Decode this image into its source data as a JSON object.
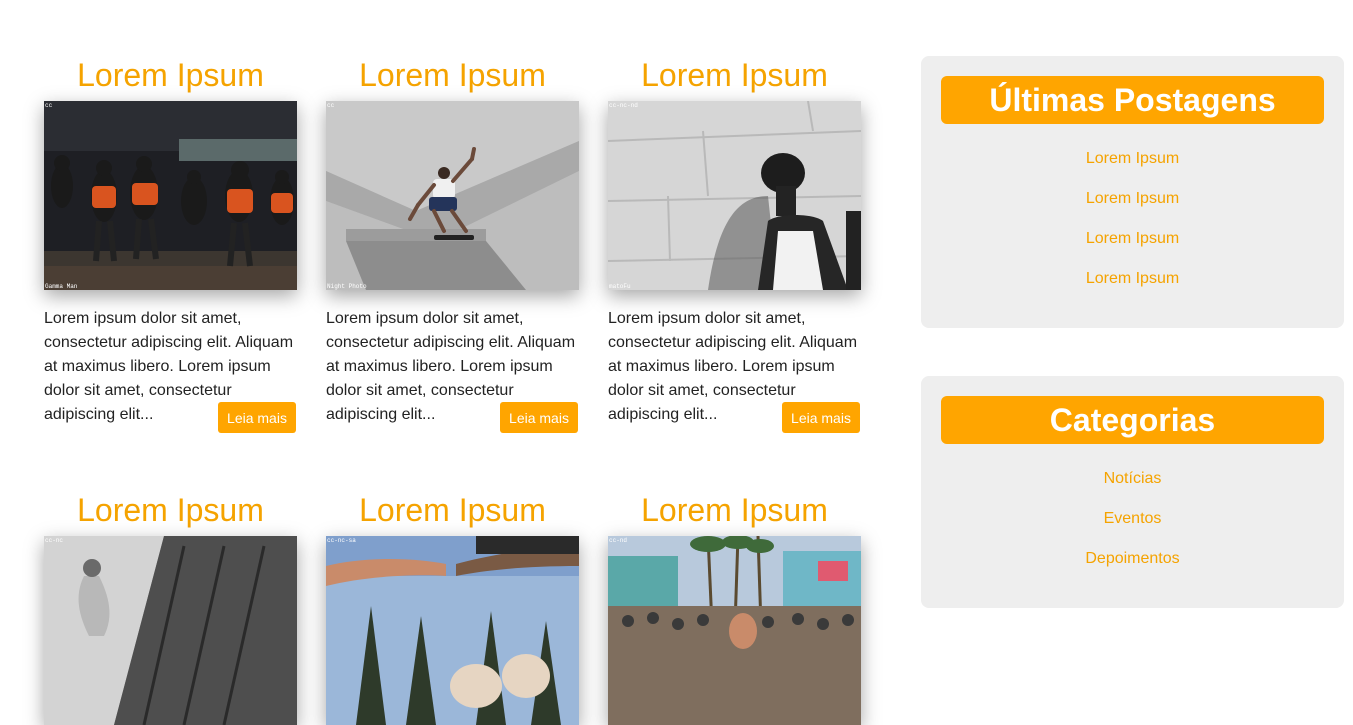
{
  "posts": [
    {
      "title": "Lorem Ipsum",
      "excerpt": "Lorem ipsum dolor sit amet, consectetur adipiscing elit. Aliquam at maximus libero. Lorem ipsum dolor sit amet, consectetur adipiscing elit...",
      "button": "Leia mais",
      "caption_top": "cc",
      "caption_bottom": "Gamma Man"
    },
    {
      "title": "Lorem Ipsum",
      "excerpt": "Lorem ipsum dolor sit amet, consectetur adipiscing elit. Aliquam at maximus libero. Lorem ipsum dolor sit amet, consectetur adipiscing elit...",
      "button": "Leia mais",
      "caption_top": "cc",
      "caption_bottom": "Night Photo"
    },
    {
      "title": "Lorem Ipsum",
      "excerpt": "Lorem ipsum dolor sit amet, consectetur adipiscing elit. Aliquam at maximus libero. Lorem ipsum dolor sit amet, consectetur adipiscing elit...",
      "button": "Leia mais",
      "caption_top": "cc-nc-nd",
      "caption_bottom": "matoFu"
    },
    {
      "title": "Lorem Ipsum",
      "caption_top": "cc-nc"
    },
    {
      "title": "Lorem Ipsum",
      "caption_top": "cc-nc-sa"
    },
    {
      "title": "Lorem Ipsum",
      "caption_top": "cc-nd"
    }
  ],
  "sidebar": {
    "latest": {
      "title": "Últimas Postagens",
      "links": [
        "Lorem Ipsum",
        "Lorem Ipsum",
        "Lorem Ipsum",
        "Lorem Ipsum"
      ]
    },
    "categories": {
      "title": "Categorias",
      "links": [
        "Notícias",
        "Eventos",
        "Depoimentos"
      ]
    }
  },
  "colors": {
    "accent": "#ffa500",
    "title": "#f5a300",
    "widget_bg": "#eeeeee"
  }
}
